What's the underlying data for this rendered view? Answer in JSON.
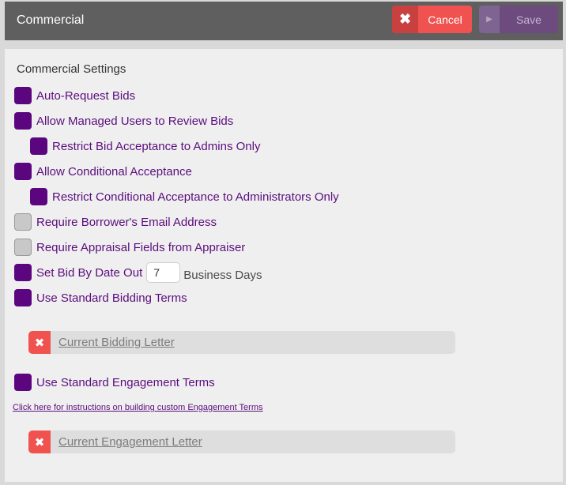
{
  "header": {
    "title": "Commercial",
    "cancel_label": "Cancel",
    "save_label": "Save"
  },
  "section_title": "Commercial Settings",
  "options": [
    {
      "label": "Auto-Request Bids",
      "checked": true
    },
    {
      "label": "Allow Managed Users to Review Bids",
      "checked": true
    },
    {
      "label": "Restrict Bid Acceptance to Admins Only",
      "checked": true
    },
    {
      "label": "Allow Conditional Acceptance",
      "checked": true
    },
    {
      "label": "Restrict Conditional Acceptance to Administrators Only",
      "checked": true
    },
    {
      "label": "Require Borrower's Email Address",
      "checked": false
    },
    {
      "label": "Require Appraisal Fields from Appraiser",
      "checked": false
    },
    {
      "label": "Set Bid By Date Out",
      "checked": true
    },
    {
      "label": "Use Standard Bidding Terms",
      "checked": true
    },
    {
      "label": "Use Standard Engagement Terms",
      "checked": true
    }
  ],
  "bid_by_date": {
    "value": "7",
    "suffix": "Business Days"
  },
  "bidding_letter": "Current Bidding Letter",
  "engagement_instructions": "Click here for instructions on building custom Engagement Terms",
  "engagement_letter": "Current Engagement Letter",
  "colors": {
    "accent": "#5b067f",
    "cancel": "#f0524f",
    "header": "#5f5f5f"
  },
  "icons": {
    "cancel": "close-icon",
    "save": "play-icon",
    "remove_letter": "close-icon"
  }
}
